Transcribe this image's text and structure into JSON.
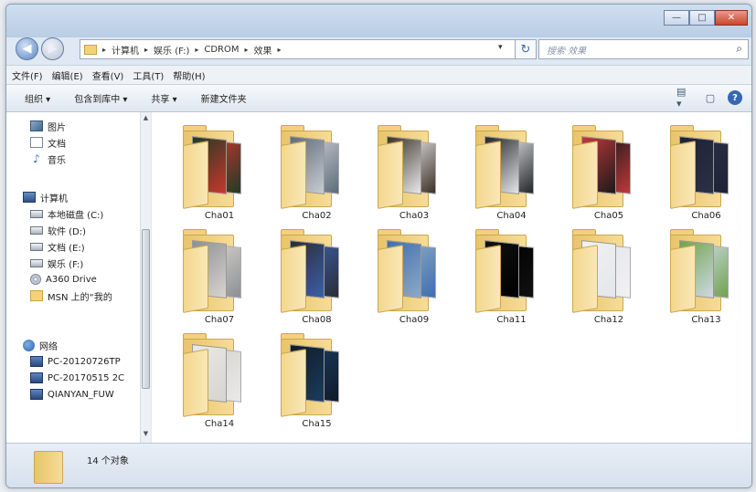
{
  "window": {
    "controls": {
      "minimize": "—",
      "maximize": "□",
      "close": "✕"
    }
  },
  "nav": {
    "back_icon": "back-arrow-icon",
    "forward_icon": "forward-arrow-icon",
    "breadcrumb": [
      "计算机",
      "娱乐 (F:)",
      "CDROM",
      "效果"
    ],
    "breadcrumb_sep": "▸",
    "address_dropdown": "▾",
    "refresh_icon": "↻",
    "search_placeholder": "搜索 效果",
    "search_icon": "⌕"
  },
  "menubar": {
    "items": [
      "文件(F)",
      "编辑(E)",
      "查看(V)",
      "工具(T)",
      "帮助(H)"
    ]
  },
  "toolbar": {
    "organize": "组织 ▾",
    "include_library": "包含到库中 ▾",
    "share": "共享 ▾",
    "new_folder": "新建文件夹",
    "view_icon": "▤ ▾",
    "pane_icon": "▢",
    "help_icon": "?"
  },
  "sidebar": {
    "items": [
      {
        "label": "图片",
        "icon": "picture-icon"
      },
      {
        "label": "文档",
        "icon": "document-icon"
      },
      {
        "label": "音乐",
        "icon": "music-icon",
        "glyph": "♪"
      },
      {
        "label": "计算机",
        "icon": "computer-icon"
      },
      {
        "label": "本地磁盘 (C:)",
        "icon": "drive-icon"
      },
      {
        "label": "软件 (D:)",
        "icon": "drive-icon"
      },
      {
        "label": "文档 (E:)",
        "icon": "drive-icon"
      },
      {
        "label": "娱乐 (F:)",
        "icon": "drive-icon"
      },
      {
        "label": "A360 Drive",
        "icon": "cloud-drive-icon"
      },
      {
        "label": "MSN 上的“我的",
        "icon": "folder-icon"
      },
      {
        "label": "网络",
        "icon": "network-icon"
      },
      {
        "label": "PC-20120726TP",
        "icon": "host-icon"
      },
      {
        "label": "PC-20170515 2C",
        "icon": "host-icon"
      },
      {
        "label": "QIANYAN_FUW",
        "icon": "host-icon"
      }
    ]
  },
  "folders": [
    {
      "name": "Cha01",
      "c1": "#1f3a28",
      "c2": "#c9372c"
    },
    {
      "name": "Cha02",
      "c1": "#5d6b7a",
      "c2": "#c8ccd2"
    },
    {
      "name": "Cha03",
      "c1": "#3b3026",
      "c2": "#e8e8ea"
    },
    {
      "name": "Cha04",
      "c1": "#222426",
      "c2": "#e3e5e8"
    },
    {
      "name": "Cha05",
      "c1": "#c0383a",
      "c2": "#1a1a1a"
    },
    {
      "name": "Cha06",
      "c1": "#1d2236",
      "c2": "#2c3046"
    },
    {
      "name": "Cha07",
      "c1": "#8b8f93",
      "c2": "#d9d4cf"
    },
    {
      "name": "Cha08",
      "c1": "#2a2c33",
      "c2": "#3b5fa8"
    },
    {
      "name": "Cha09",
      "c1": "#3d6fb0",
      "c2": "#8fa8c4"
    },
    {
      "name": "Cha11",
      "c1": "#111111",
      "c2": "#000000"
    },
    {
      "name": "Cha12",
      "c1": "#f1f1f3",
      "c2": "#e5e6ea"
    },
    {
      "name": "Cha13",
      "c1": "#6ea34e",
      "c2": "#cfd9e2"
    },
    {
      "name": "Cha14",
      "c1": "#ebe9e6",
      "c2": "#d6d4d0"
    },
    {
      "name": "Cha15",
      "c1": "#0f1b2a",
      "c2": "#1b3c5d"
    }
  ],
  "status": {
    "count": "14 个对象"
  }
}
